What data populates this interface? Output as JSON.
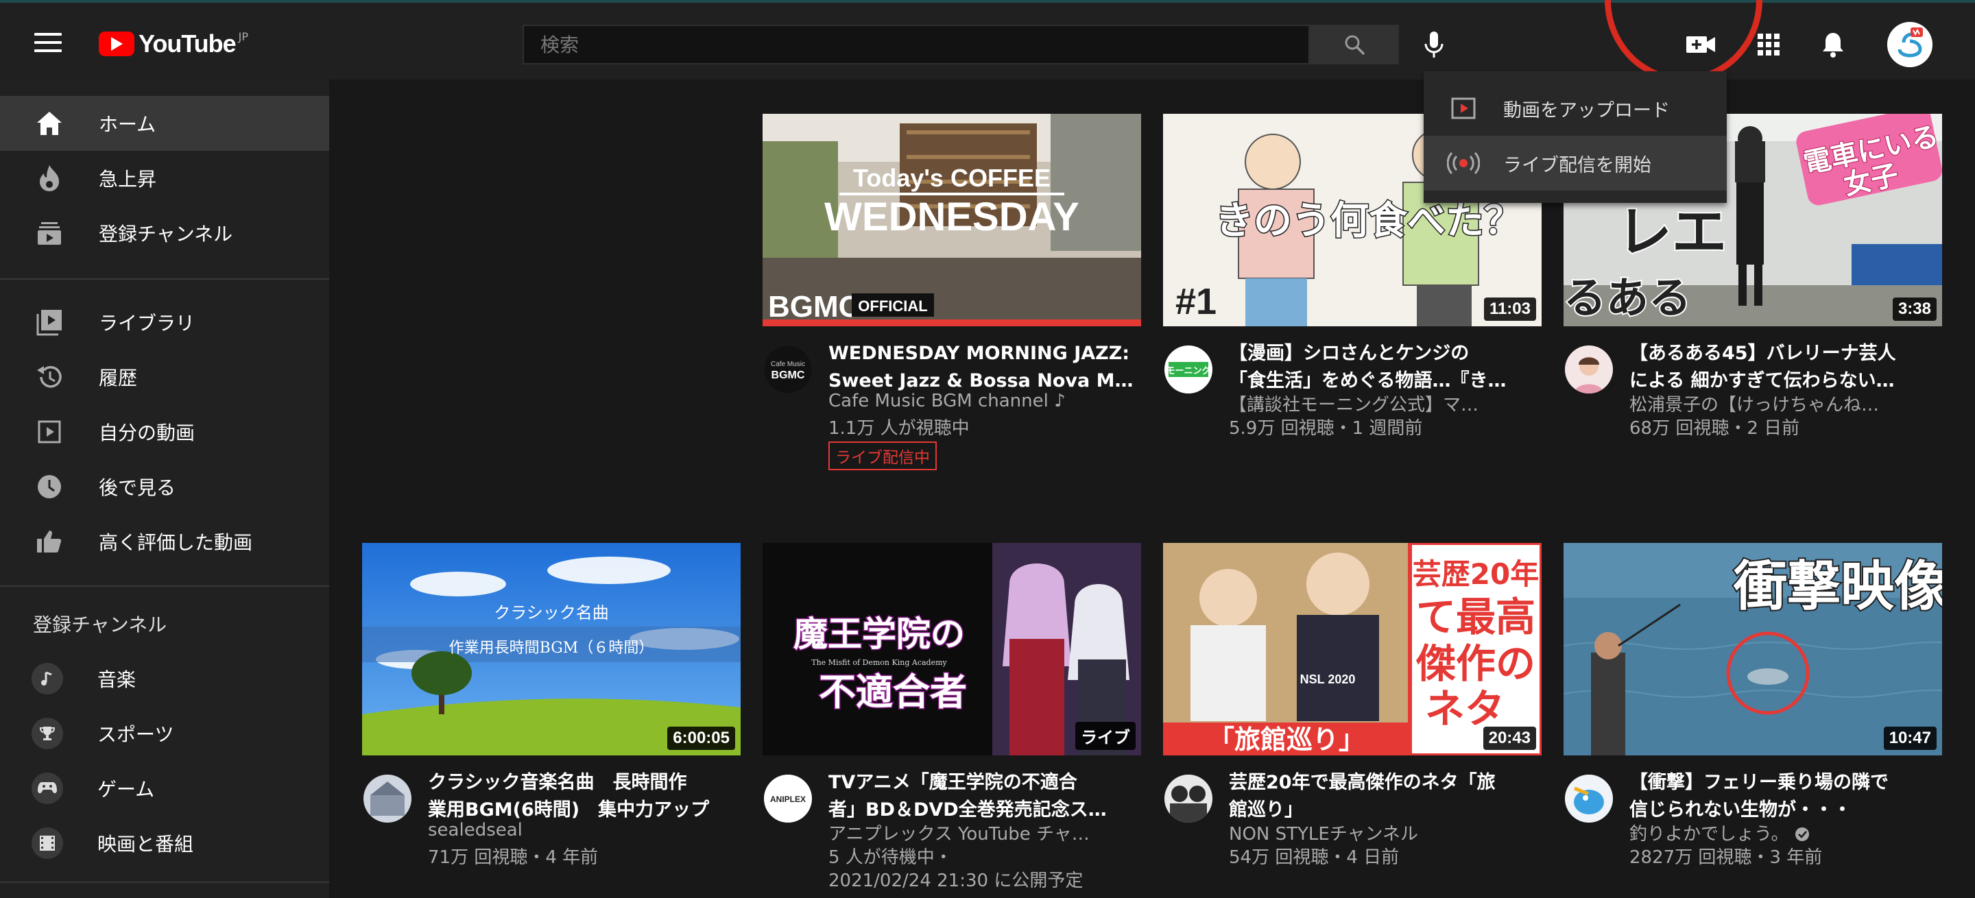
{
  "header": {
    "logo_text": "YouTube",
    "logo_region": "JP",
    "search_placeholder": "検索"
  },
  "create_menu": {
    "items": [
      {
        "label": "動画をアップロード",
        "icon": "upload-video-icon"
      },
      {
        "label": "ライブ配信を開始",
        "icon": "go-live-icon"
      }
    ]
  },
  "sidebar": {
    "main": [
      {
        "label": "ホーム",
        "icon": "home-icon",
        "active": true
      },
      {
        "label": "急上昇",
        "icon": "trending-icon"
      },
      {
        "label": "登録チャンネル",
        "icon": "subscriptions-icon"
      }
    ],
    "library": [
      {
        "label": "ライブラリ",
        "icon": "library-icon"
      },
      {
        "label": "履歴",
        "icon": "history-icon"
      },
      {
        "label": "自分の動画",
        "icon": "your-videos-icon"
      },
      {
        "label": "後で見る",
        "icon": "watch-later-icon"
      },
      {
        "label": "高く評価した動画",
        "icon": "liked-videos-icon"
      }
    ],
    "subscriptions_heading": "登録チャンネル",
    "subscriptions": [
      {
        "label": "音楽",
        "icon": "music-icon"
      },
      {
        "label": "スポーツ",
        "icon": "trophy-icon"
      },
      {
        "label": "ゲーム",
        "icon": "gamepad-icon"
      },
      {
        "label": "映画と番組",
        "icon": "film-icon"
      }
    ]
  },
  "videos": [
    {
      "title_l1": "WEDNESDAY MORNING JAZZ:",
      "title_l2": "Sweet Jazz & Bossa Nova Mus…",
      "channel": "Cafe Music BGM channel ♪",
      "stats": "1.1万 人が視聴中",
      "badge": "ライブ配信中",
      "thumb_text1": "Today's COFFEE",
      "thumb_text2": "WEDNESDAY",
      "thumb_text3": "OFFICIAL",
      "thumb_logo": "BGMC",
      "avatar_text1": "Cafe Music",
      "avatar_text2": "BGMC"
    },
    {
      "title_l1": "【漫画】シロさんとケンジの",
      "title_l2": "「食生活」をめぐる物語…『き…",
      "channel": "【講談社モーニング公式】マ…",
      "stats": "5.9万 回視聴・1 週間前",
      "duration": "11:03",
      "thumb_text1": "きのう何食べた？",
      "thumb_text2": "#1",
      "avatar_text1": "モーニング"
    },
    {
      "title_l1": "【あるある45】バレリーナ芸人",
      "title_l2": "による 細かすぎて伝わらない…",
      "channel": "松浦景子の【けっけちゃんね…",
      "stats": "68万 回視聴・2 日前",
      "duration": "3:38",
      "thumb_text1": "電車にいる",
      "thumb_text2": "女子",
      "thumb_text3": "るある",
      "thumb_text4": "レエ"
    },
    {
      "title_l1": "クラシック音楽名曲　長時間作",
      "title_l2": "業用BGM(6時間)　集中力アップ",
      "channel": "sealedseal",
      "stats": "71万 回視聴・4 年前",
      "duration": "6:00:05",
      "thumb_text1": "クラシック名曲",
      "thumb_text2": "作業用長時間BGM（６時間）"
    },
    {
      "title_l1": "TVアニメ「魔王学院の不適合",
      "title_l2": "者」BD＆DVD全巻発売記念ス…",
      "channel": "アニプレックス YouTube チャ…",
      "stats": "5 人が待機中・",
      "stats2": "2021/02/24 21:30 に公開予定",
      "duration": "ライブ",
      "thumb_text1": "魔王学院の",
      "thumb_text2": "不適合者",
      "thumb_text3": "The Misfit of Demon King Academy",
      "avatar_text1": "ANIPLEX"
    },
    {
      "title_l1": "芸歴20年で最高傑作のネタ「旅",
      "title_l2": "館巡り」",
      "channel": "NON STYLEチャンネル",
      "stats": "54万 回視聴・4 日前",
      "duration": "20:43",
      "thumb_text1": "芸歴20年",
      "thumb_text2": "て最高",
      "thumb_text3": "傑作の",
      "thumb_text4": "ネタ",
      "thumb_text5": "「旅館巡り」",
      "thumb_text6": "NSL 2020"
    },
    {
      "title_l1": "【衝撃】フェリー乗り場の隣で",
      "title_l2": "信じられない生物が・・・",
      "channel": "釣りよかでしょう。",
      "stats": "2827万 回視聴・3 年前",
      "duration": "10:47",
      "thumb_text1": "衝撃映像"
    }
  ]
}
